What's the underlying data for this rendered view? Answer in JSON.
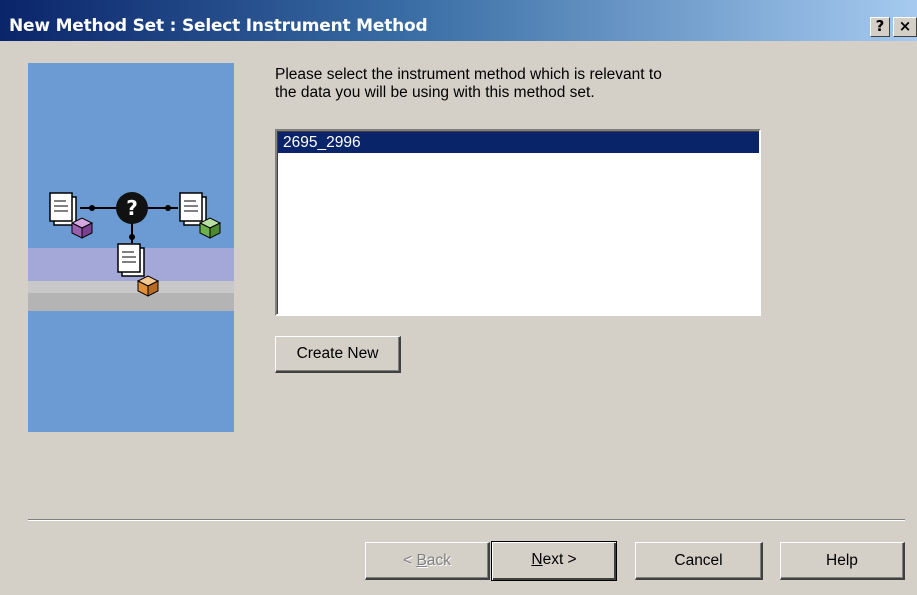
{
  "window": {
    "title": "New Method Set : Select Instrument Method",
    "help_glyph": "?",
    "close_glyph": "×"
  },
  "illustration": {
    "center_glyph": "?",
    "icons": [
      "method-document-purple-cube-icon",
      "question-mark-icon",
      "method-document-green-cube-icon",
      "method-document-orange-cube-icon"
    ],
    "colors": {
      "panel": "#6b9bd2",
      "band_light": "#a4a8d8",
      "band_gray": "#b8b8b8"
    }
  },
  "instruction": {
    "line1": "Please select the instrument method which is relevant to",
    "line2": "the data you will be using with this method set."
  },
  "method_list": {
    "items": [
      "2695_2996"
    ],
    "selected": "2695_2996"
  },
  "buttons": {
    "create_new": "Create New",
    "back_mnemonic": "B",
    "back_prefix": "< ",
    "back_rest": "ack",
    "next_mnemonic": "N",
    "next_rest": "ext >",
    "cancel": "Cancel",
    "help": "Help"
  },
  "colors": {
    "title_start": "#0a246a",
    "title_end": "#a6caf0",
    "selection": "#0a246a",
    "dialog_bg": "#d4d0c8"
  }
}
